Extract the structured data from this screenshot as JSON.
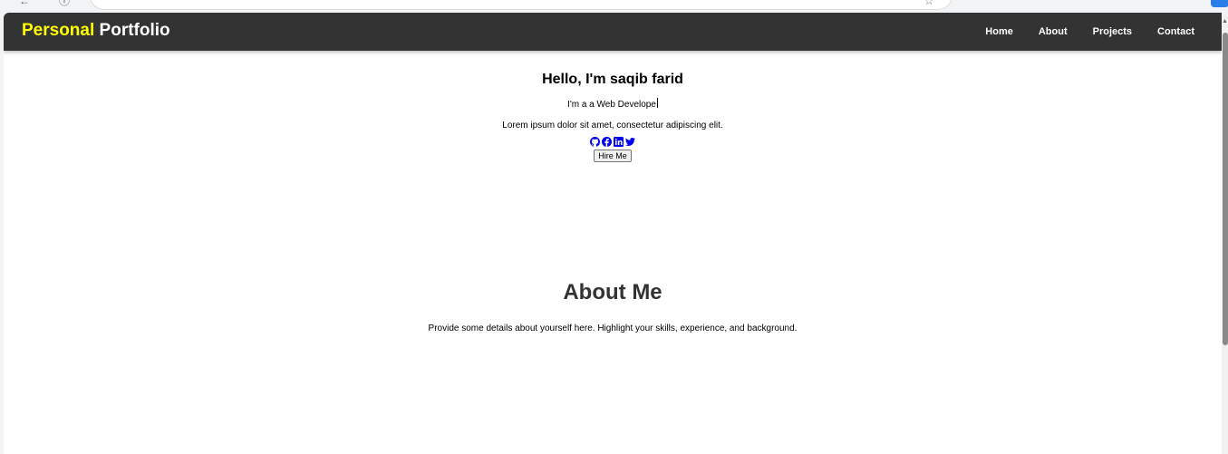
{
  "navbar": {
    "logo_accent": "Personal",
    "logo_rest": " Portfolio",
    "links": [
      "Home",
      "About",
      "Projects",
      "Contact"
    ]
  },
  "hero": {
    "title": "Hello, I'm saqib farid",
    "typing_text": "I'm a a Web Develope",
    "description": "Lorem ipsum dolor sit amet, consectetur adipiscing elit.",
    "social_icons": [
      "github-icon",
      "facebook-icon",
      "linkedin-icon",
      "twitter-icon"
    ],
    "hire_button": "Hire Me"
  },
  "about": {
    "title": "About Me",
    "text": "Provide some details about yourself here. Highlight your skills, experience, and background."
  },
  "colors": {
    "navbar_bg": "#333333",
    "logo_accent": "#ffff00",
    "icon_blue": "#0000ee"
  }
}
